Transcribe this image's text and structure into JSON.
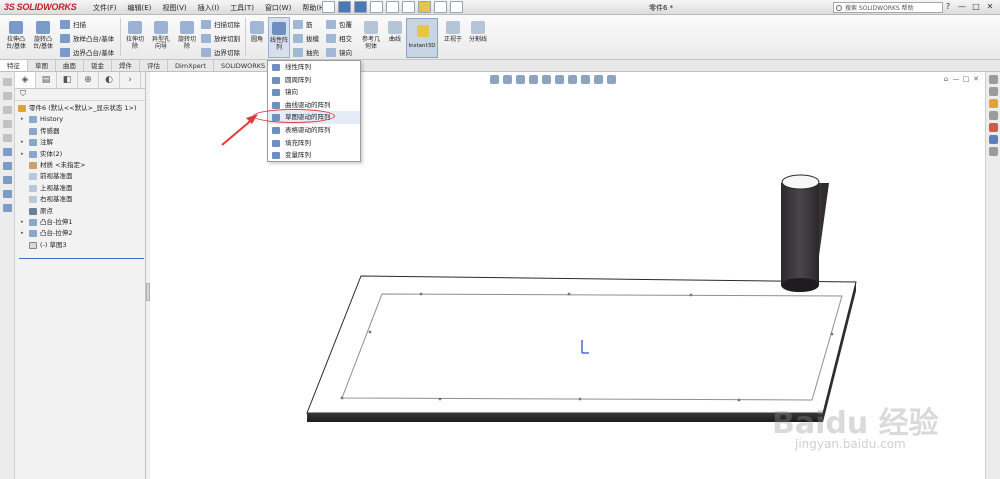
{
  "titlebar": {
    "logo_ds": "3S",
    "logo_text": "SOLIDWORKS",
    "menu": [
      "文件(F)",
      "编辑(E)",
      "视图(V)",
      "插入(I)",
      "工具(T)",
      "窗口(W)",
      "帮助(H)"
    ],
    "doc_title": "零件6 *",
    "search_placeholder": "搜索 SOLIDWORKS 帮助",
    "window_controls": [
      "?",
      "—",
      "□",
      "✕"
    ]
  },
  "ribbon": {
    "extrude_boss": "拉伸凸\n台/基体",
    "revolve_boss": "旋转凸\n台/基体",
    "sweep": "扫描",
    "loft_boss": "放样凸台/基体",
    "boundary_boss": "边界凸台/基体",
    "extrude_cut": "拉伸切\n除",
    "hole_wizard": "异型孔\n向导",
    "revolve_cut": "旋转切\n除",
    "swept_cut": "扫描切除",
    "lofted_cut": "放样切割",
    "boundary_cut": "边界切除",
    "fillet": "圆角",
    "linear_pattern": "线性阵\n列",
    "rib": "筋",
    "draft": "拔模",
    "shell": "抽壳",
    "wrap": "包覆",
    "intersect": "相交",
    "mirror": "镜向",
    "ref_geometry": "参考几\n何体",
    "curves": "曲线",
    "instant3d": "Instant3D",
    "normal_to": "正视于",
    "split_line": "分割线"
  },
  "tabs": [
    "特征",
    "草图",
    "曲面",
    "钣金",
    "焊件",
    "评估",
    "DimXpert",
    "SOLIDWORKS 插件"
  ],
  "feature_tree": {
    "root": "零件6 (默认<<默认>_显示状态 1>)",
    "items": [
      "History",
      "传感器",
      "注解",
      "实体(2)",
      "材质 <未指定>",
      "前视基准面",
      "上视基准面",
      "右视基准面",
      "原点",
      "凸台-拉伸1",
      "凸台-拉伸2",
      "(-) 草图3"
    ]
  },
  "pattern_menu": {
    "items": [
      "线性阵列",
      "圆周阵列",
      "镜向",
      "曲线驱动的阵列",
      "草图驱动的阵列",
      "表格驱动的阵列",
      "填充阵列",
      "变量阵列"
    ],
    "highlighted": "草图驱动的阵列"
  },
  "watermark": {
    "main": "Baidu 经验",
    "sub": "jingyan.baidu.com"
  },
  "colors": {
    "accent": "#3b6fc7",
    "logo": "#c0202a",
    "annotation": "#e03b3b"
  }
}
